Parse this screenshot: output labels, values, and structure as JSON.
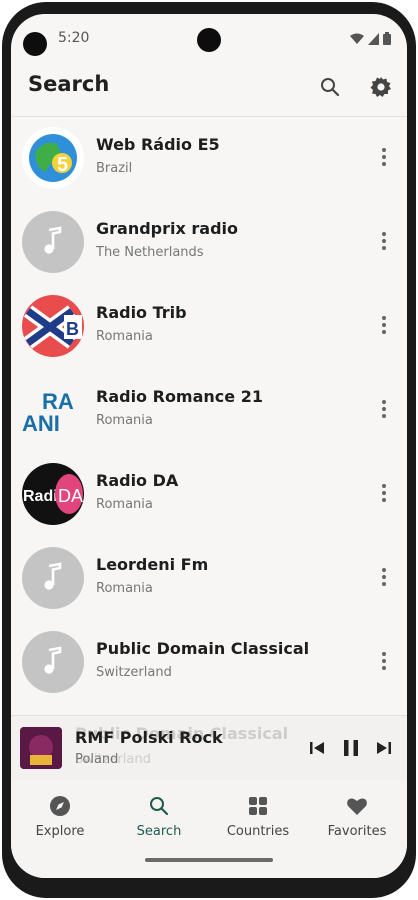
{
  "status_bar": {
    "time": "5:20"
  },
  "app_bar": {
    "title": "Search",
    "search_icon": "search-icon",
    "settings_icon": "gear-icon"
  },
  "stations": [
    {
      "name": "Web Rádio E5",
      "country": "Brazil",
      "logo": "web-radio-e5-logo"
    },
    {
      "name": "Grandprix radio",
      "country": "The Netherlands",
      "logo": "music-note-placeholder-icon"
    },
    {
      "name": "Radio Trib",
      "country": "Romania",
      "logo": "radio-trib-logo"
    },
    {
      "name": "Radio Romance 21",
      "country": "Romania",
      "logo": "radio-romance-logo",
      "logo_text": "RA ANI"
    },
    {
      "name": "Radio DA",
      "country": "Romania",
      "logo": "radio-da-logo",
      "logo_text_left": "Radio",
      "logo_text_right": "DA"
    },
    {
      "name": "Leordeni Fm",
      "country": "Romania",
      "logo": "music-note-placeholder-icon"
    },
    {
      "name": "Public Domain Classical",
      "country": "Switzerland",
      "logo": "music-note-placeholder-icon"
    }
  ],
  "partially_hidden_row": {
    "name": "Public Domain Classical",
    "country": "Switzerland"
  },
  "player": {
    "title": "RMF Polski Rock",
    "country": "Poland"
  },
  "nav": [
    {
      "label": "Explore",
      "icon": "compass-icon",
      "active": false
    },
    {
      "label": "Search",
      "icon": "search-icon",
      "active": true
    },
    {
      "label": "Countries",
      "icon": "grid-icon",
      "active": false
    },
    {
      "label": "Favorites",
      "icon": "heart-icon",
      "active": false
    }
  ],
  "colors": {
    "accent": "#1c5c4f",
    "background": "#f7f6f5",
    "placeholder": "#c4c4c4"
  }
}
